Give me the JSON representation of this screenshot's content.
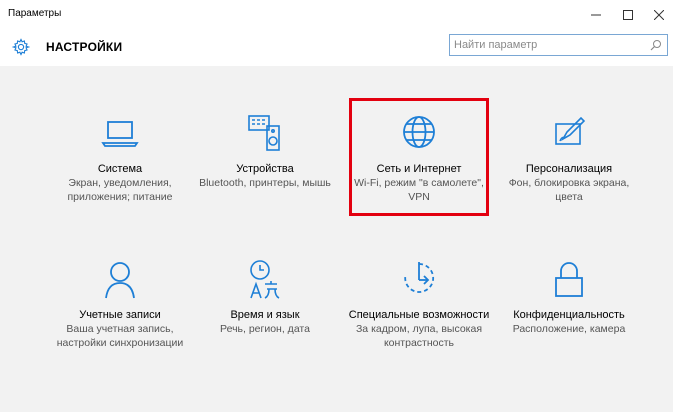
{
  "window": {
    "title": "Параметры"
  },
  "header": {
    "title": "НАСТРОЙКИ"
  },
  "search": {
    "placeholder": "Найти параметр"
  },
  "colors": {
    "accent": "#1e7fd6",
    "highlight": "#e3000f"
  },
  "tiles": [
    {
      "icon": "laptop-icon",
      "name": "Система",
      "desc": "Экран, уведомления, приложения; питание"
    },
    {
      "icon": "devices-icon",
      "name": "Устройства",
      "desc": "Bluetooth, принтеры, мышь"
    },
    {
      "icon": "globe-icon",
      "name": "Сеть и Интернет",
      "desc": "Wi-Fi, режим \"в самолете\", VPN"
    },
    {
      "icon": "personalization-icon",
      "name": "Персонализация",
      "desc": "Фон, блокировка экрана, цвета"
    },
    {
      "icon": "person-icon",
      "name": "Учетные записи",
      "desc": "Ваша учетная запись, настройки синхронизации"
    },
    {
      "icon": "time-language-icon",
      "name": "Время и язык",
      "desc": "Речь, регион, дата"
    },
    {
      "icon": "accessibility-icon",
      "name": "Специальные возможности",
      "desc": "За кадром, лупа, высокая контрастность"
    },
    {
      "icon": "lock-icon",
      "name": "Конфиденциальность",
      "desc": "Расположение, камера"
    }
  ]
}
